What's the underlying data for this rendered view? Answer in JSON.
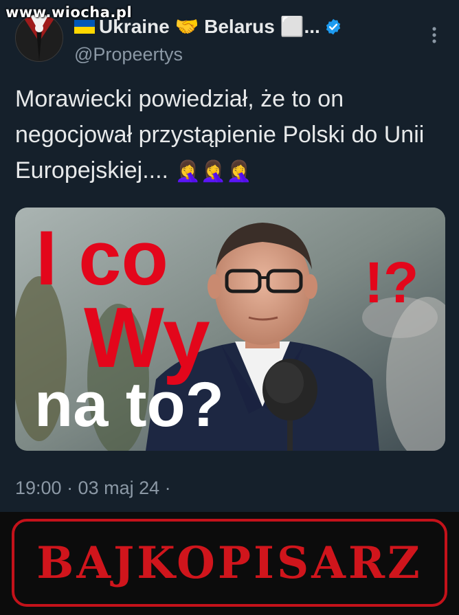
{
  "watermark": "www.wiocha.pl",
  "author": {
    "display_name": "Ukraine 🤝 Belarus ⬜...",
    "handle": "@Propeertys"
  },
  "tweet": {
    "text": "Morawiecki powiedział, że to on negocjował przystąpienie Polski do Unii Europejskiej....",
    "emoji": "🤦‍♀️🤦‍♀️🤦‍♀️"
  },
  "media": {
    "line1": "I co",
    "line2": "Wy",
    "line3": "na to?",
    "marks": "!?"
  },
  "timestamp": "19:00 · 03 maj 24 ·",
  "banner": {
    "label": "BAJKOPISARZ"
  },
  "colors": {
    "background": "#15202b",
    "text": "#e7e9ea",
    "muted": "#8b98a5",
    "verified": "#1d9bf0",
    "overlay_red": "#e3061b",
    "banner_red": "#c4121a"
  },
  "icons": [
    "ukraine-flag-icon",
    "verified-badge-icon",
    "more-options-icon"
  ]
}
